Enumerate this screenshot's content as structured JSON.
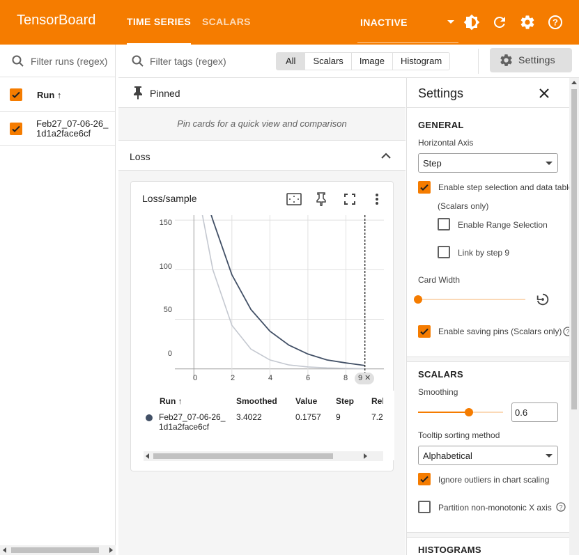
{
  "header": {
    "brand": "TensorBoard",
    "tabs": [
      {
        "label": "TIME SERIES",
        "active": true
      },
      {
        "label": "SCALARS",
        "active": false
      }
    ],
    "status": "INACTIVE",
    "icons": [
      "brightness-icon",
      "refresh-icon",
      "gear-icon",
      "help-icon"
    ]
  },
  "runs": {
    "filter_placeholder": "Filter runs (regex)",
    "header_label": "Run ↑",
    "items": [
      {
        "label": "Feb27_07-06-26_1d1a2face6cf",
        "checked": true
      }
    ]
  },
  "tags": {
    "filter_placeholder": "Filter tags (regex)",
    "types": [
      "All",
      "Scalars",
      "Image",
      "Histogram"
    ],
    "selected_type": "All",
    "settings_label": "Settings"
  },
  "pinned": {
    "title": "Pinned",
    "empty_text": "Pin cards for a quick view and comparison"
  },
  "group": {
    "title": "Loss"
  },
  "card": {
    "title": "Loss/sample",
    "x_ticks": [
      "0",
      "2",
      "4",
      "6",
      "8"
    ],
    "y_ticks": [
      "150",
      "100",
      "50",
      "0"
    ],
    "step_marker": "9 ✕",
    "columns": [
      "Run ↑",
      "Smoothed",
      "Value",
      "Step",
      "Rel"
    ],
    "row": {
      "run": "Feb27_07-06-26_1d1a2face6cf",
      "smoothed": "3.4022",
      "value": "0.1757",
      "step": "9",
      "relative": "7.2",
      "color": "#425066"
    }
  },
  "chart_data": {
    "type": "line",
    "title": "Loss/sample",
    "xlim": [
      -1,
      10
    ],
    "ylim": [
      -10,
      155
    ],
    "series": [
      {
        "name": "Feb27_07-06-26_1d1a2face6cf",
        "color": "#425066",
        "x": [
          0,
          1,
          2,
          3,
          4,
          5,
          6,
          7,
          8,
          9
        ],
        "y": [
          210,
          150,
          95,
          60,
          38,
          24,
          15,
          9,
          6,
          3.4
        ]
      },
      {
        "color": "#c4c8d0",
        "x": [
          0,
          1,
          2,
          3,
          4,
          5,
          6,
          7,
          8,
          9
        ],
        "y": [
          200,
          100,
          44,
          20,
          9,
          4,
          2,
          1,
          0.5,
          0.18
        ]
      }
    ],
    "marker_step": 9,
    "grid": true
  },
  "settings": {
    "title": "Settings",
    "general": {
      "section": "GENERAL",
      "horizontal_axis_label": "Horizontal Axis",
      "horizontal_axis_value": "Step",
      "step_selection_label": "Enable step selection and data table",
      "step_selection_note": "(Scalars only)",
      "step_selection_checked": true,
      "range_selection_label": "Enable Range Selection",
      "range_selection_checked": false,
      "link_step_label": "Link by step 9",
      "link_step_checked": false,
      "card_width_label": "Card Width",
      "card_width_value": 0,
      "saving_pins_label": "Enable saving pins (Scalars only)",
      "saving_pins_checked": true
    },
    "scalars": {
      "section": "SCALARS",
      "smoothing_label": "Smoothing",
      "smoothing_value": "0.6",
      "tooltip_label": "Tooltip sorting method",
      "tooltip_value": "Alphabetical",
      "ignore_outliers_label": "Ignore outliers in chart scaling",
      "ignore_outliers_checked": true,
      "partition_label": "Partition non-monotonic X axis",
      "partition_checked": false
    },
    "histograms": {
      "section": "HISTOGRAMS"
    }
  },
  "colors": {
    "accent": "#f57c00",
    "series_smoothed": "#425066",
    "series_raw": "#c4c8d0"
  }
}
